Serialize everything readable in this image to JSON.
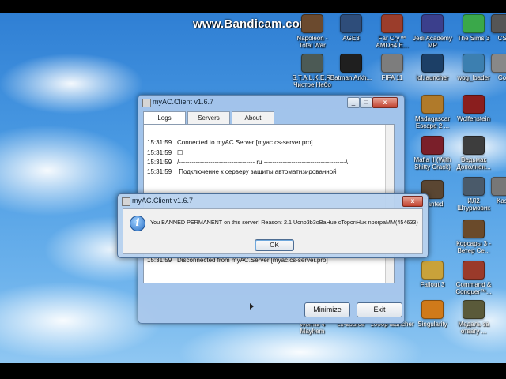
{
  "watermark": "www.Bandicam.com",
  "desktop_icons": [
    {
      "label": "Napoleon - Total War",
      "color": "#6b4a2e"
    },
    {
      "label": "AGE3",
      "color": "#2e4d7a"
    },
    {
      "label": "Far Cry™ AMD64 E...",
      "color": "#9b3d2b"
    },
    {
      "label": "Jedi Academy MP",
      "color": "#3b3f8c"
    },
    {
      "label": "The Sims 3",
      "color": "#3aa84a"
    },
    {
      "label": "CS",
      "color": "#555555"
    },
    {
      "label": "S.T.A.L.K.E.R. Чистое Небо",
      "color": "#4c5a55"
    },
    {
      "label": "Batman Arkh...",
      "color": "#1f1f1f"
    },
    {
      "label": "FIFA 11",
      "color": "#7d7d7d"
    },
    {
      "label": "lol.launcher",
      "color": "#1c3f66"
    },
    {
      "label": "wog_loader",
      "color": "#3c7fb0"
    },
    {
      "label": "Co",
      "color": "#888888"
    },
    {
      "label": "Madagascar Escape 2 ...",
      "color": "#b07a2a"
    },
    {
      "label": "Wolfenstein",
      "color": "#8a1e1e"
    },
    {
      "label": "Mafia II (With Shitty Crack)",
      "color": "#7a1f2a"
    },
    {
      "label": "Ведьмак Дополнен...",
      "color": "#3d3d3d"
    },
    {
      "label": "Wanted",
      "color": "#5a4632"
    },
    {
      "label": "ИЛ2 Штурмовик",
      "color": "#4a5a6a"
    },
    {
      "label": "Kas",
      "color": "#777777"
    },
    {
      "label": "Корсары 3 - Ветер Се...",
      "color": "#6a4a2a"
    },
    {
      "label": "Fallout 3",
      "color": "#c9a23a"
    },
    {
      "label": "Command & Conquer™...",
      "color": "#9a3a2a"
    },
    {
      "label": "Singularity",
      "color": "#d07a1a"
    },
    {
      "label": "Медаль за отвагу ...",
      "color": "#5a5a3a"
    },
    {
      "label": "Worms 4 Mayhem",
      "color": "#6a8a3a"
    },
    {
      "label": "cs-source",
      "color": "#6b6b6b"
    },
    {
      "label": "1000p launcher",
      "color": "#3a5a8a"
    }
  ],
  "main_window": {
    "title": "myAC.Client  v1.6.7",
    "tabs": [
      "Logs",
      "Servers",
      "About"
    ],
    "log_lines": [
      {
        "time": "15:31:59",
        "text": "Connected to myAC.Server [myac.cs-server.pro]"
      },
      {
        "time": "15:31:59",
        "text": "☐"
      },
      {
        "time": "15:31:59",
        "text": "/------------------------------------ ru ---------------------------------------\\"
      },
      {
        "time": "15:31:59",
        "text": "      Подключение к серверу защиты автоматизированной"
      },
      {
        "time": "15:31:59",
        "text": "Disconnected from myAC.Server [myac.cs-server.pro]"
      }
    ],
    "minimize_label": "Minimize",
    "exit_label": "Exit"
  },
  "dialog": {
    "title": "myAC.Client  v1.6.7",
    "message": "You BANNED PERMANENT on this server! Reason: 2.1 Ucno3b3oBaHue cToporiHux nporpaMM(454633)",
    "ok_label": "OK",
    "close_label": "x"
  }
}
